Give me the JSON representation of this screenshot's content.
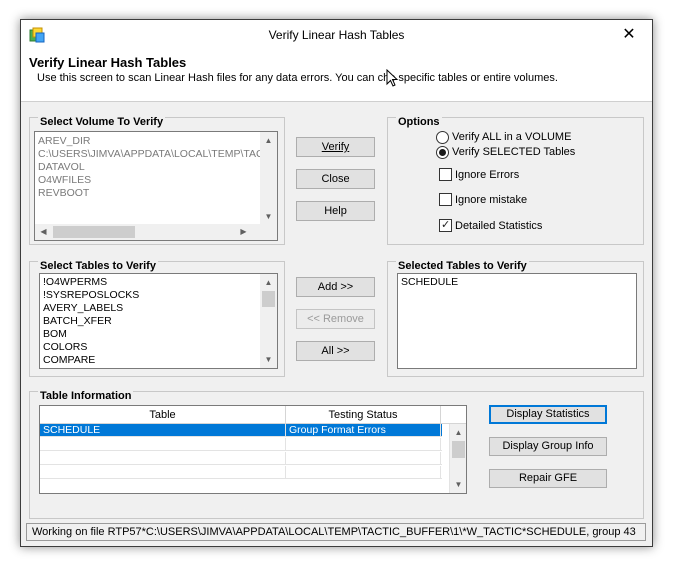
{
  "window": {
    "title": "Verify Linear Hash Tables",
    "close_glyph": "✕"
  },
  "header": {
    "title": "Verify Linear Hash Tables",
    "description": "Use this screen to scan Linear Hash files for any data errors. You can che  specific tables or entire volumes."
  },
  "volume_group": {
    "label": "Select Volume To Verify",
    "items": [
      "AREV_DIR",
      "C:\\USERS\\JIMVA\\APPDATA\\LOCAL\\TEMP\\TAC",
      "DATAVOL",
      "O4WFILES",
      "REVBOOT"
    ]
  },
  "buttons": {
    "verify": "Verify",
    "close": "Close",
    "help": "Help",
    "add": "Add >>",
    "remove": "<< Remove",
    "all": "All >>",
    "display_statistics": "Display Statistics",
    "display_group_info": "Display Group Info",
    "repair_gfe": "Repair GFE"
  },
  "options": {
    "label": "Options",
    "verify_all": "Verify ALL in a VOLUME",
    "verify_selected": "Verify SELECTED Tables",
    "ignore_errors": "Ignore Errors",
    "ignore_mistake": "Ignore mistake",
    "detailed_statistics": "Detailed Statistics",
    "verify_mode": "selected",
    "ignore_errors_checked": false,
    "ignore_mistake_checked": false,
    "detailed_statistics_checked": true
  },
  "tables_group": {
    "label": "Select Tables to Verify",
    "items": [
      "!O4WPERMS",
      "!SYSREPOSLOCKS",
      "AVERY_LABELS",
      "BATCH_XFER",
      "BOM",
      "COLORS",
      "COMPARE"
    ]
  },
  "selected_group": {
    "label": "Selected Tables to Verify",
    "items": [
      "SCHEDULE"
    ]
  },
  "table_info": {
    "label": "Table Information",
    "columns": [
      "Table",
      "Testing Status"
    ],
    "rows": [
      {
        "table": "SCHEDULE",
        "status": "Group Format Errors"
      }
    ]
  },
  "status_bar": {
    "text": "Working on file RTP57*C:\\USERS\\JIMVA\\APPDATA\\LOCAL\\TEMP\\TACTIC_BUFFER\\1\\*W_TACTIC*SCHEDULE, group 43"
  },
  "colors": {
    "selection": "#0078d7",
    "dialog_bg": "#f0f0f0"
  },
  "icons": [
    "app-icon",
    "close-icon",
    "mouse-cursor-icon",
    "scroll-arrow-icon"
  ]
}
